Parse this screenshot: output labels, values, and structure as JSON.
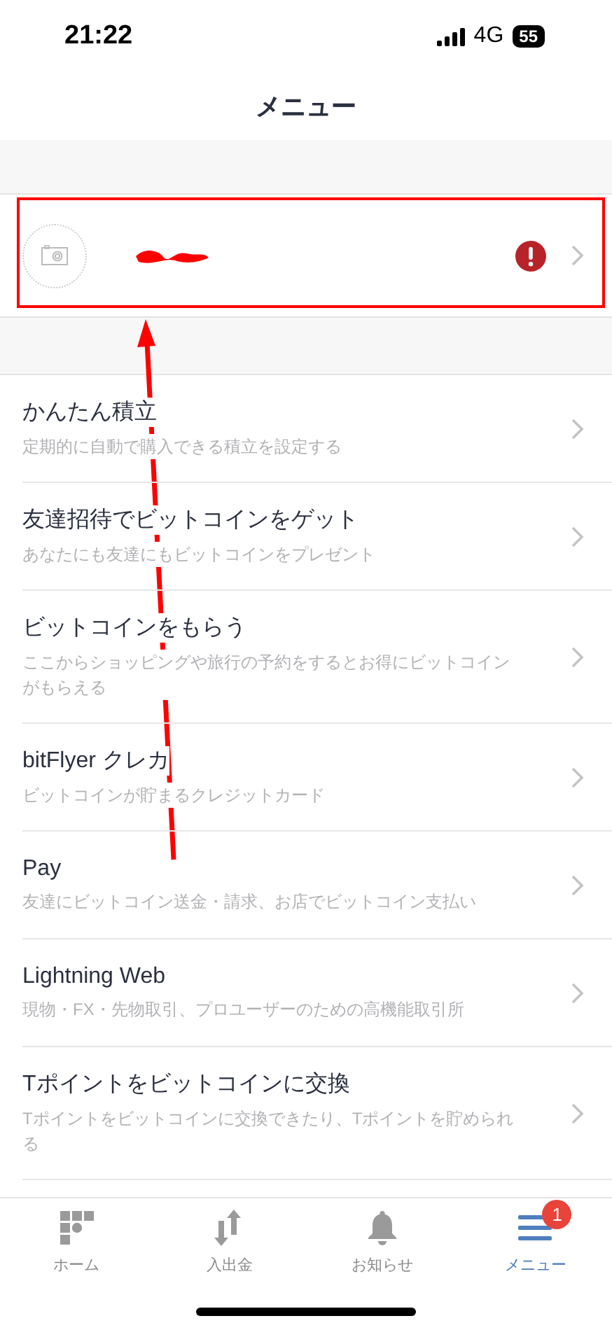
{
  "status_bar": {
    "time": "21:22",
    "network": "4G",
    "battery": "55"
  },
  "header": {
    "title": "メニュー"
  },
  "profile": {
    "alert": true
  },
  "menu_items": [
    {
      "title": "かんたん積立",
      "subtitle": "定期的に自動で購入できる積立を設定する"
    },
    {
      "title": "友達招待でビットコインをゲット",
      "subtitle": "あなたにも友達にもビットコインをプレゼント"
    },
    {
      "title": "ビットコインをもらう",
      "subtitle": "ここからショッピングや旅行の予約をするとお得にビットコインがもらえる"
    },
    {
      "title": "bitFlyer クレカ",
      "subtitle": "ビットコインが貯まるクレジットカード"
    },
    {
      "title": "Pay",
      "subtitle": "友達にビットコイン送金・請求、お店でビットコイン支払い"
    },
    {
      "title": "Lightning Web",
      "subtitle": "現物・FX・先物取引、プロユーザーのための高機能取引所"
    },
    {
      "title": "Tポイントをビットコインに交換",
      "subtitle": "Tポイントをビットコインに交換できたり、Tポイントを貯められる"
    }
  ],
  "tab_bar": [
    {
      "kind": "home",
      "label": "ホーム",
      "selected": false
    },
    {
      "kind": "transfer",
      "label": "入出金",
      "selected": false
    },
    {
      "kind": "bell",
      "label": "お知らせ",
      "selected": false
    },
    {
      "kind": "menu",
      "label": "メニュー",
      "selected": true,
      "badge": "1"
    }
  ],
  "annotations": [
    {
      "kind": "box"
    },
    {
      "kind": "arrow"
    },
    {
      "kind": "scribble"
    }
  ]
}
